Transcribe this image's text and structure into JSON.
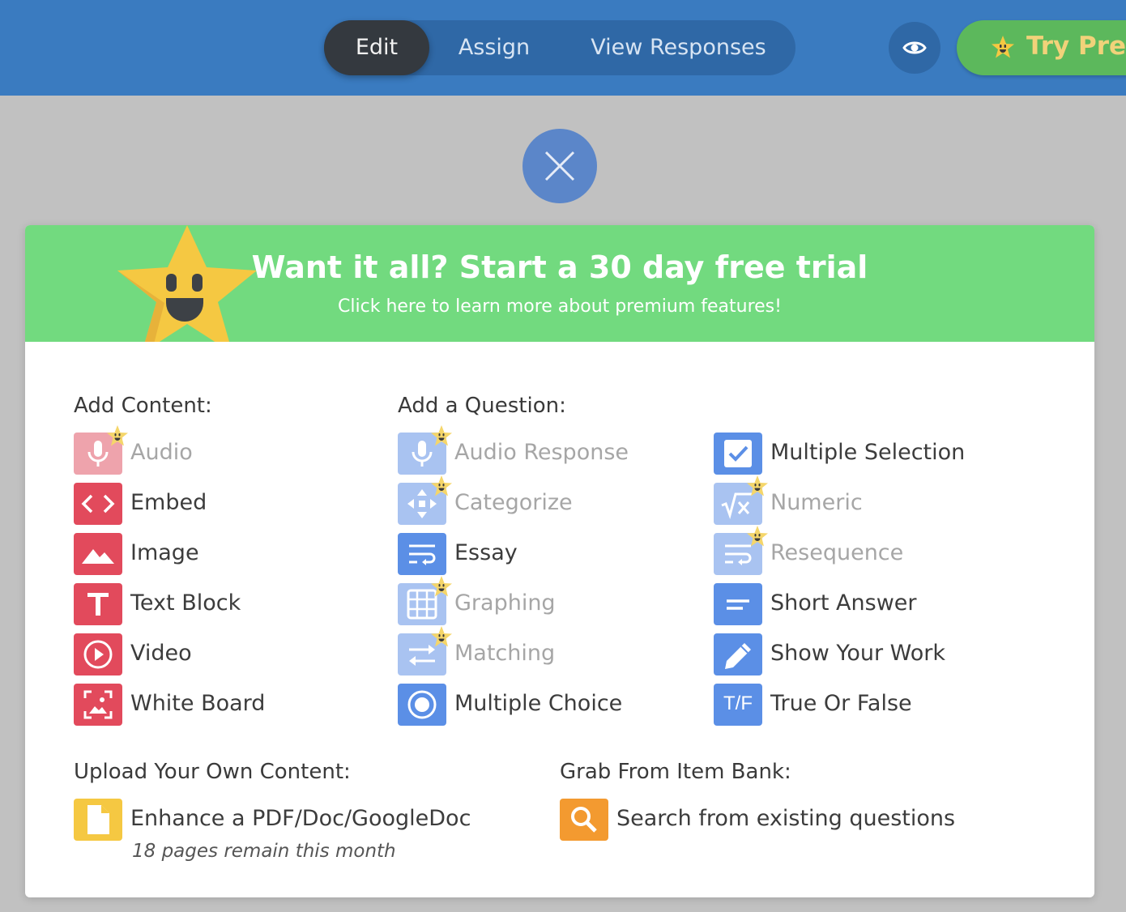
{
  "topbar": {
    "tabs": [
      {
        "label": "Edit",
        "active": true
      },
      {
        "label": "Assign",
        "active": false
      },
      {
        "label": "View Responses",
        "active": false
      }
    ],
    "preview_icon": "eye-icon",
    "premium_button_label": "Try Pren"
  },
  "close_icon": "close-icon",
  "banner": {
    "title": "Want it all? Start a 30 day free trial",
    "subtitle": "Click here to learn more about premium features!"
  },
  "add_content": {
    "title": "Add Content:",
    "items": [
      {
        "label": "Audio",
        "icon": "microphone-icon",
        "premium": true
      },
      {
        "label": "Embed",
        "icon": "code-icon",
        "premium": false
      },
      {
        "label": "Image",
        "icon": "image-icon",
        "premium": false
      },
      {
        "label": "Text Block",
        "icon": "text-icon",
        "premium": false
      },
      {
        "label": "Video",
        "icon": "play-icon",
        "premium": false
      },
      {
        "label": "White Board",
        "icon": "whiteboard-icon",
        "premium": false
      }
    ]
  },
  "add_question": {
    "title": "Add a Question:",
    "column1": [
      {
        "label": "Audio Response",
        "icon": "microphone-icon",
        "premium": true
      },
      {
        "label": "Categorize",
        "icon": "move-arrows-icon",
        "premium": true
      },
      {
        "label": "Essay",
        "icon": "wrap-text-icon",
        "premium": false
      },
      {
        "label": "Graphing",
        "icon": "grid-icon",
        "premium": true
      },
      {
        "label": "Matching",
        "icon": "swap-arrows-icon",
        "premium": true
      },
      {
        "label": "Multiple Choice",
        "icon": "radio-icon",
        "premium": false
      }
    ],
    "column2": [
      {
        "label": "Multiple Selection",
        "icon": "checkbox-icon",
        "premium": false
      },
      {
        "label": "Numeric",
        "icon": "square-root-icon",
        "premium": true
      },
      {
        "label": "Resequence",
        "icon": "wrap-text-icon",
        "premium": true
      },
      {
        "label": "Short Answer",
        "icon": "short-lines-icon",
        "premium": false
      },
      {
        "label": "Show Your Work",
        "icon": "pencil-icon",
        "premium": false
      },
      {
        "label": "True Or False",
        "icon": "true-false-icon",
        "icon_text": "T/F",
        "premium": false
      }
    ]
  },
  "upload": {
    "title": "Upload Your Own Content:",
    "item_label": "Enhance a PDF/Doc/GoogleDoc",
    "icon": "document-icon",
    "note": "18 pages remain this month"
  },
  "item_bank": {
    "title": "Grab From Item Bank:",
    "item_label": "Search from existing questions",
    "icon": "search-icon"
  },
  "colors": {
    "topbar": "#3a7bc0",
    "banner": "#72da7f",
    "content_red": "#e24a5c",
    "question_blue": "#5b8fe6",
    "upload_yellow": "#f5c842",
    "bank_orange": "#f39a30"
  }
}
